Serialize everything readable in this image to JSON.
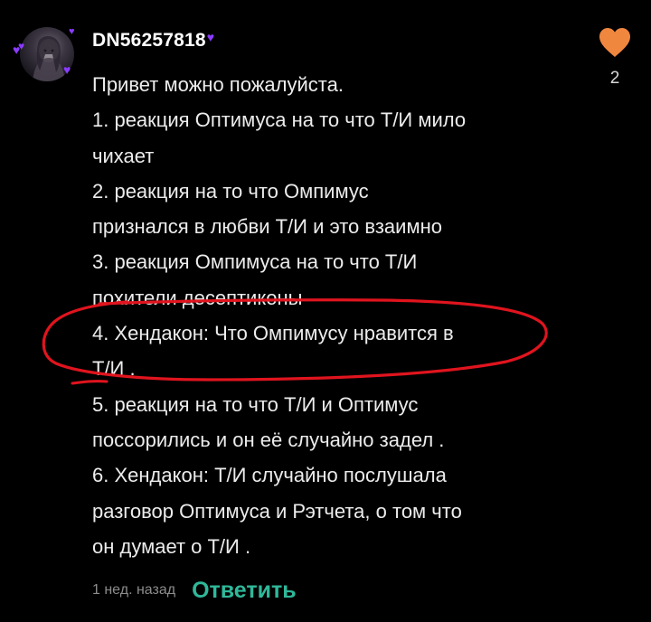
{
  "comment": {
    "username": "DN56257818",
    "lines": [
      "Привет можно пожалуйста.",
      "1. реакция Оптимуса на то что Т/И мило",
      "чихает",
      "2. реакция на то что Омпимус",
      "признался в любви Т/И и это взаимно",
      "3. реакция Омпимуса на то что Т/И",
      "похители десептиконы",
      "4. Хендакон: Что Омпимусу нравится в",
      "Т/И .",
      "5. реакция на то что Т/И и Оптимус",
      "поссорились и он её случайно задел .",
      "6. Хендакон: Т/И случайно послушала",
      "разговор Оптимуса и Рэтчета, о том что",
      "он думает о Т/И ."
    ],
    "timestamp": "1 нед. назад",
    "reply_label": "Ответить",
    "like_count": "2"
  },
  "icons": {
    "like": "heart-icon",
    "decoration": "purple-heart-icon"
  },
  "colors": {
    "background": "#000000",
    "like_heart": "#f0873f",
    "reply": "#2fb89a",
    "annotation_circle": "#e0141e",
    "decor_heart": "#8a3cff"
  }
}
